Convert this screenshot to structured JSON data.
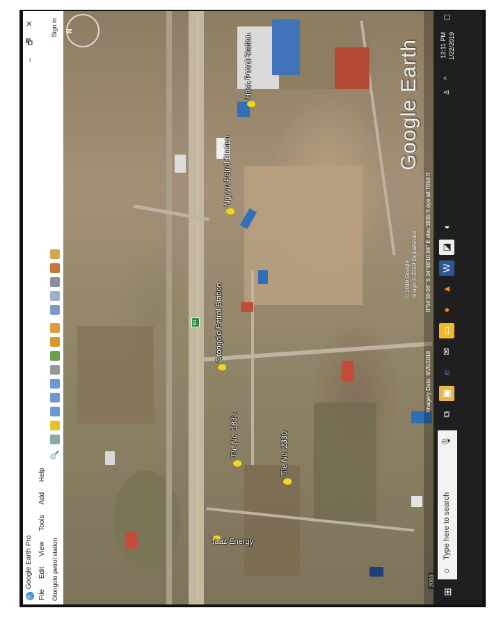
{
  "window": {
    "title": "Google Earth Pro",
    "minimize": "–",
    "maximize": "🗗",
    "close": "✕"
  },
  "menu": [
    "File",
    "Edit",
    "View",
    "Tools",
    "Add",
    "Help"
  ],
  "search": {
    "value": "Otongolo petrol station",
    "sign_in": "Sign in"
  },
  "toolbar_icons": [
    "hide-sidebar-icon",
    "placemark-icon",
    "polygon-icon",
    "path-icon",
    "image-overlay-icon",
    "record-tour-icon",
    "historical-imagery-icon",
    "sunlight-icon",
    "planets-icon",
    "ruler-icon",
    "email-icon",
    "print-icon",
    "save-image-icon",
    "maps-icon"
  ],
  "placemarks": [
    {
      "label": "Taaz Energy"
    },
    {
      "label": "Tile No. 1833"
    },
    {
      "label": "Tile No. 2330"
    },
    {
      "label": "Otongolo Petrol Station"
    },
    {
      "label": "Nguvu Petrol Station"
    },
    {
      "label": "Hass Petrol Station"
    }
  ],
  "road_shield": "B1",
  "map": {
    "year": "2003",
    "copyright_1": "© 2019 Google",
    "copyright_2": "Image © 2019 DigitalGlobe",
    "watermark": "Google Earth",
    "imagery_date": "Imagery Date: 9/25/2018",
    "coordinates": "0°54'30.06\" S  34°48'10.94\" E  elev 3835 ft  eye alt 7059 ft"
  },
  "taskbar": {
    "search_placeholder": "Type here to search",
    "time": "12:11 PM",
    "date": "1/22/2019"
  },
  "colors": {
    "pin": "#f2d51c",
    "road_line": "#e4c93a",
    "taskbar": "#1f1f1f",
    "roof_blue": "#2f6fb5",
    "roof_red": "#b24a36"
  }
}
